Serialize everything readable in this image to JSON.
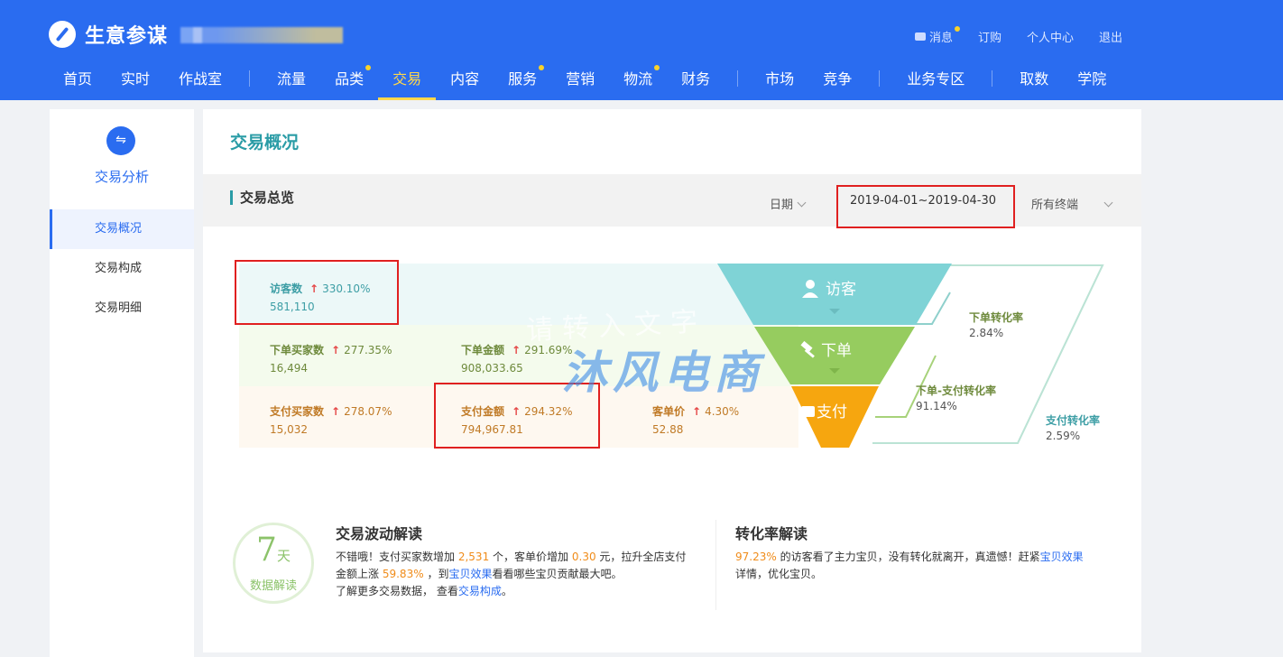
{
  "header": {
    "app_title": "生意参谋",
    "user_links": [
      "消息",
      "订购",
      "个人中心",
      "退出"
    ],
    "nav": [
      "首页",
      "实时",
      "作战室",
      "流量",
      "品类",
      "交易",
      "内容",
      "服务",
      "营销",
      "物流",
      "财务",
      "市场",
      "竞争",
      "业务专区",
      "取数",
      "学院"
    ],
    "active_nav": "交易"
  },
  "sidebar": {
    "title": "交易分析",
    "items": [
      "交易概况",
      "交易构成",
      "交易明细"
    ]
  },
  "main": {
    "page_title": "交易概况",
    "section_title": "交易总览",
    "date_label": "日期",
    "date_range": "2019-04-01~2019-04-30",
    "terminal": "所有终端"
  },
  "metrics": {
    "visitors": {
      "label": "访客数",
      "pct": "330.10%",
      "value": "581,110"
    },
    "order_buyers": {
      "label": "下单买家数",
      "pct": "277.35%",
      "value": "16,494"
    },
    "order_amount": {
      "label": "下单金额",
      "pct": "291.69%",
      "value": "908,033.65"
    },
    "pay_buyers": {
      "label": "支付买家数",
      "pct": "278.07%",
      "value": "15,032"
    },
    "pay_amount": {
      "label": "支付金额",
      "pct": "294.32%",
      "value": "794,967.81"
    },
    "unit_price": {
      "label": "客单价",
      "pct": "4.30%",
      "value": "52.88"
    }
  },
  "funnel": {
    "stages": [
      "访客",
      "下单",
      "支付"
    ],
    "colors": [
      "#7fd3d6",
      "#96cc5f",
      "#f6a60f"
    ],
    "rates": [
      {
        "label": "下单转化率",
        "value": "2.84%"
      },
      {
        "label": "下单-支付转化率",
        "value": "91.14%"
      },
      {
        "label": "支付转化率",
        "value": "2.59%"
      }
    ]
  },
  "watermark": {
    "line1": "请转入文字",
    "line2": "沐风电商"
  },
  "badge": {
    "num": "7",
    "unit": "天",
    "sub": "数据解读"
  },
  "interpretation": {
    "left": {
      "title": "交易波动解读",
      "t1": "不错哦！支付买家数增加",
      "v1": "2,531",
      "t2": "个，客单价增加",
      "v2": "0.30",
      "t3": "元，拉升全店支付金额上涨",
      "v3": "59.83%",
      "t4": "，到",
      "link1": "宝贝效果",
      "t5": "看看哪些宝贝贡献最大吧。",
      "t6": "了解更多交易数据，  查看",
      "link2": "交易构成",
      "t7": "。"
    },
    "right": {
      "title": "转化率解读",
      "v1": "97.23%",
      "t1": "的访客看了主力宝贝，没有转化就离开，真遗憾！赶紧",
      "link1": "宝贝效果",
      "t2": "详情，优化宝贝。"
    }
  }
}
